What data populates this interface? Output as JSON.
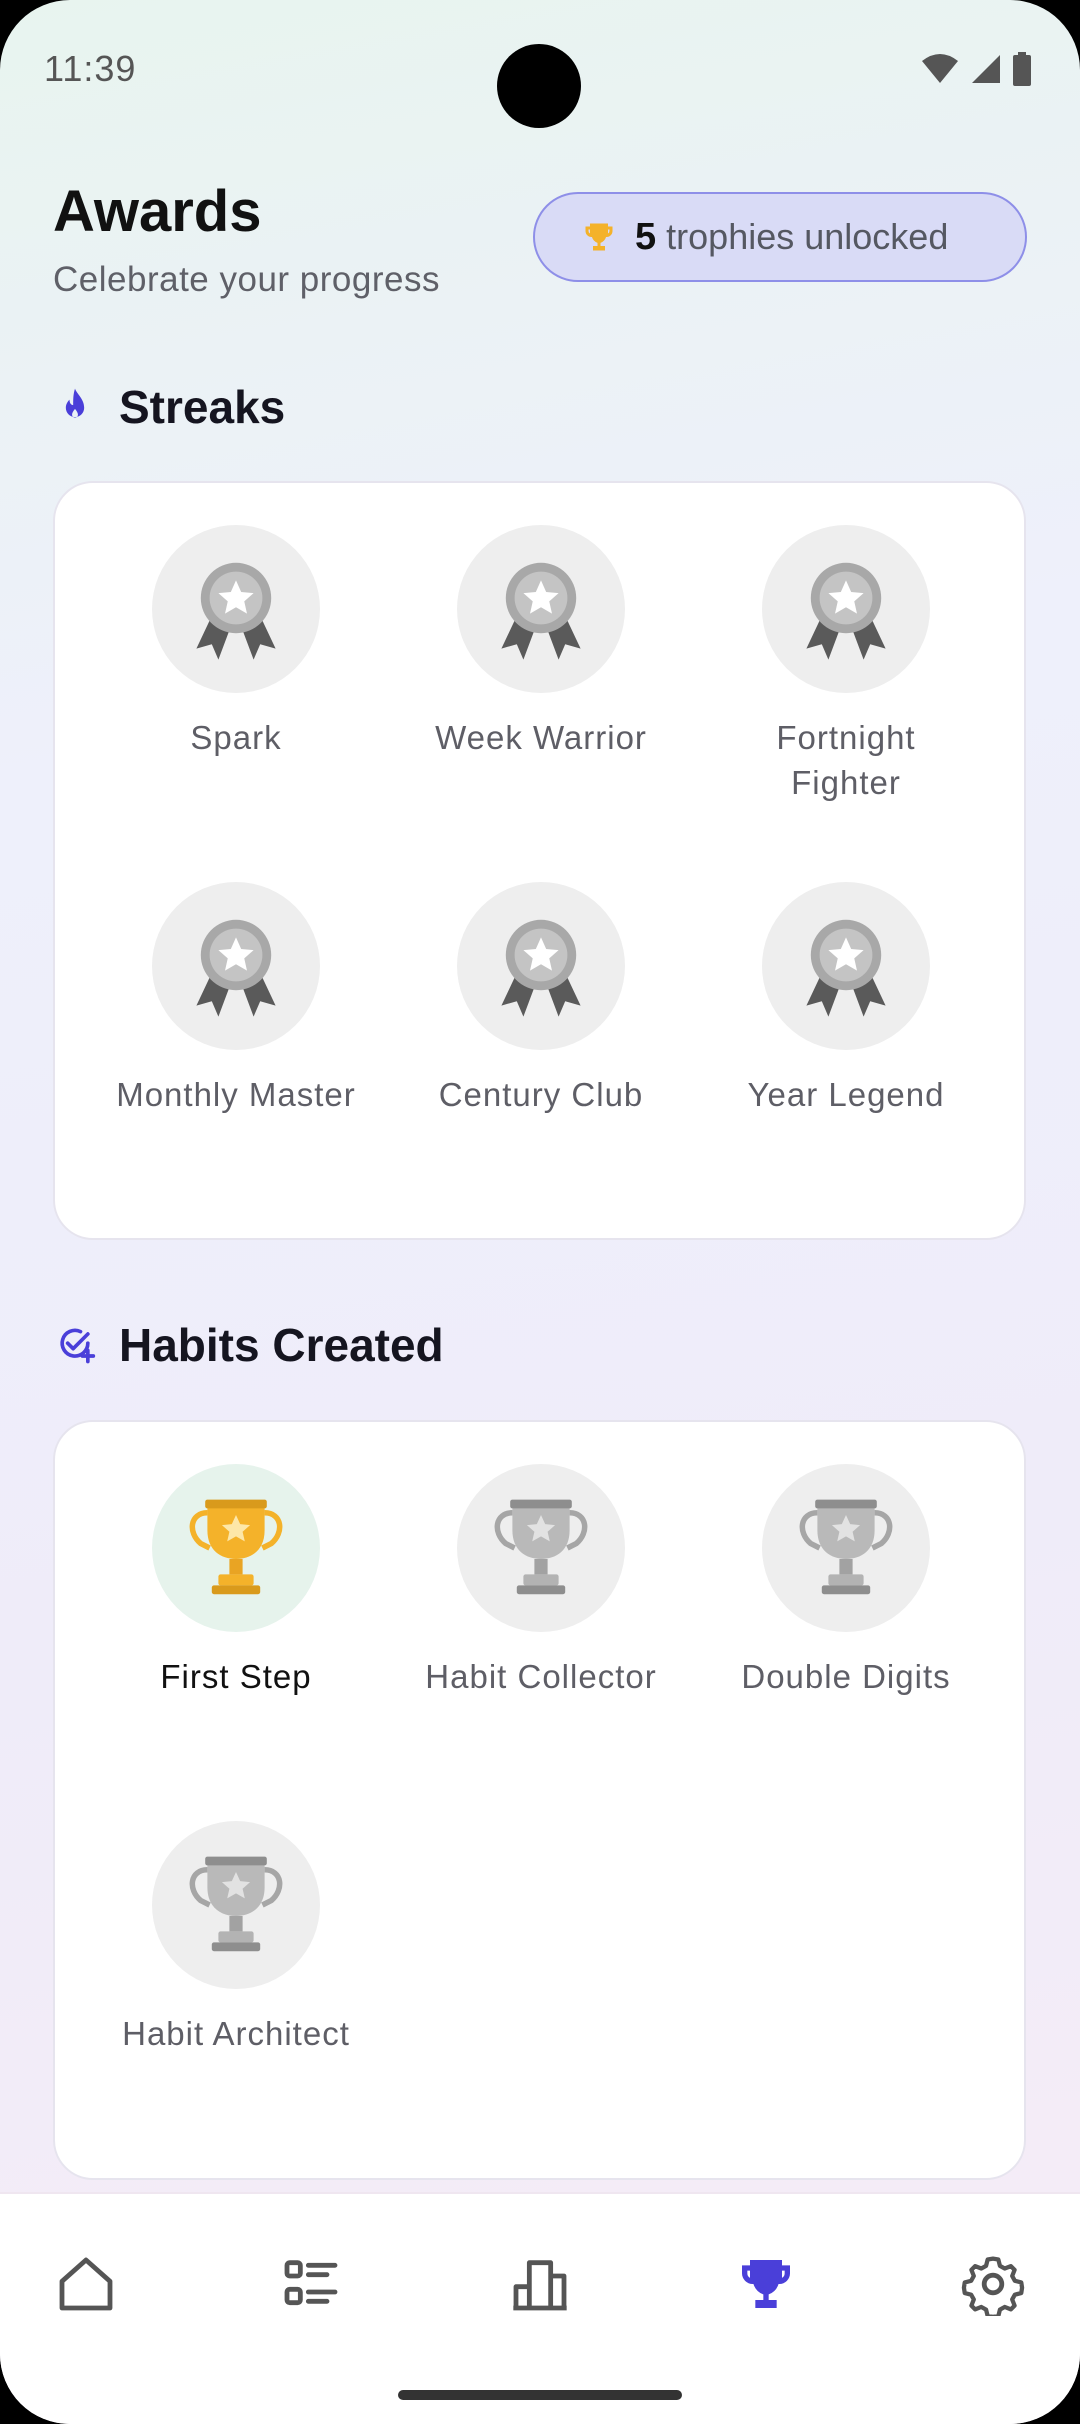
{
  "status": {
    "time": "11:39"
  },
  "header": {
    "title": "Awards",
    "subtitle": "Celebrate your progress",
    "trophies_count": "5",
    "trophies_label": "trophies unlocked"
  },
  "sections": {
    "streaks": {
      "title": "Streaks",
      "icon": "flame-icon",
      "awards": [
        {
          "name": "Spark",
          "unlocked": false
        },
        {
          "name": "Week Warrior",
          "unlocked": false
        },
        {
          "name": "Fortnight Fighter",
          "unlocked": false
        },
        {
          "name": "Monthly Master",
          "unlocked": false
        },
        {
          "name": "Century Club",
          "unlocked": false
        },
        {
          "name": "Year Legend",
          "unlocked": false
        }
      ]
    },
    "habits": {
      "title": "Habits Created",
      "icon": "check-plus-icon",
      "awards": [
        {
          "name": "First Step",
          "unlocked": true
        },
        {
          "name": "Habit Collector",
          "unlocked": false
        },
        {
          "name": "Double Digits",
          "unlocked": false
        },
        {
          "name": "Habit Architect",
          "unlocked": false
        }
      ]
    }
  },
  "nav": {
    "items": [
      {
        "icon": "home-icon",
        "active": false
      },
      {
        "icon": "list-icon",
        "active": false
      },
      {
        "icon": "stats-icon",
        "active": false
      },
      {
        "icon": "trophy-icon",
        "active": true
      },
      {
        "icon": "settings-icon",
        "active": false
      }
    ]
  },
  "colors": {
    "accent": "#4a3fd9",
    "trophy_gold": "#f4b22a",
    "medal_gray": "#9e9e9e",
    "pill_bg": "#d9dbf6"
  }
}
